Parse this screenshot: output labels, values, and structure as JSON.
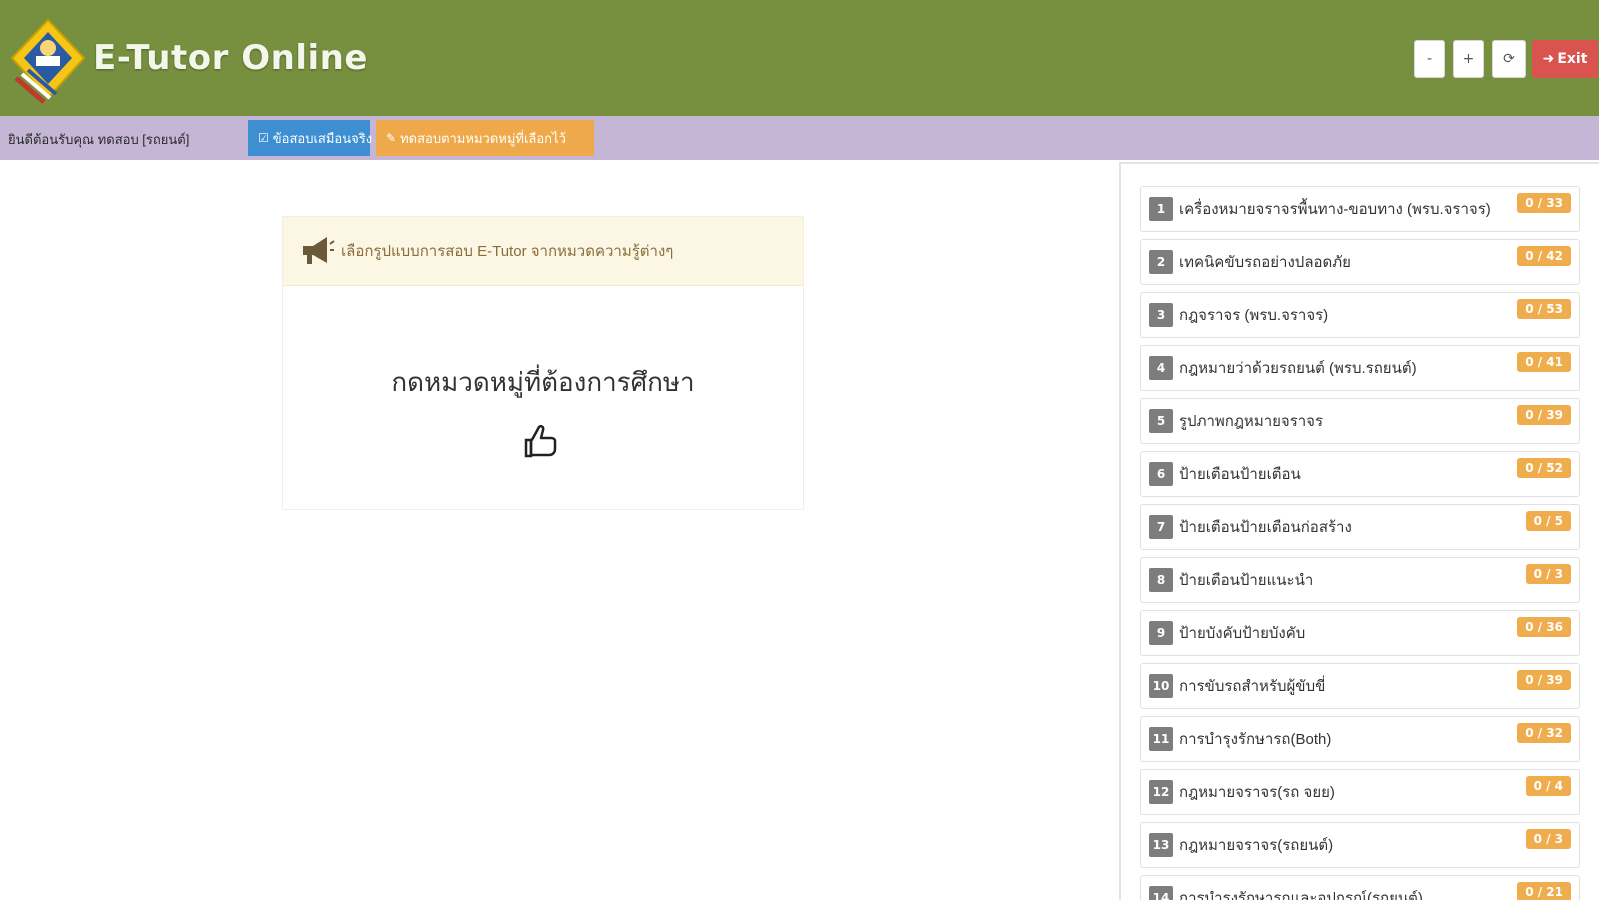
{
  "header": {
    "app_title": "E-Tutor Online",
    "buttons": [
      {
        "label": "-",
        "icon": "minus"
      },
      {
        "label": "+",
        "icon": "plus"
      },
      {
        "label": "⟳",
        "icon": "refresh-icon"
      }
    ],
    "exit_label": "Exit",
    "colors": {
      "header_bg": "#77903f",
      "exit_bg": "#d9534f"
    }
  },
  "subbar": {
    "welcome_text": "ยินดีต้อนรับคุณ ทดสอบ [รถยนต์]",
    "blue_button": "ข้อสอบเสมือนจริง",
    "orange_button": "ทดสอบตามหมวดหมู่ที่เลือกไว้",
    "colors": {
      "bar_bg": "#c5b6d6",
      "blue": "#3d8fd1",
      "orange": "#f0a94a"
    }
  },
  "info_panel": {
    "heading": "เลือกรูปแบบการสอบ E-Tutor จากหมวดความรู้ต่างๆ",
    "message": "กดหมวดหมู่ที่ต้องการศึกษา"
  },
  "categories": [
    {
      "num": "1",
      "name": "เครื่องหมายจราจรพื้นทาง-ขอบทาง (พรบ.จราจร)",
      "count": "0 / 33"
    },
    {
      "num": "2",
      "name": "เทคนิคขับรถอย่างปลอดภัย",
      "count": "0 / 42"
    },
    {
      "num": "3",
      "name": "กฎจราจร (พรบ.จราจร)",
      "count": "0 / 53"
    },
    {
      "num": "4",
      "name": "กฎหมายว่าด้วยรถยนต์ (พรบ.รถยนต์)",
      "count": "0 / 41"
    },
    {
      "num": "5",
      "name": "รูปภาพกฎหมายจราจร",
      "count": "0 / 39"
    },
    {
      "num": "6",
      "name": "ป้ายเตือนป้ายเตือน",
      "count": "0 / 52"
    },
    {
      "num": "7",
      "name": "ป้ายเตือนป้ายเตือนก่อสร้าง",
      "count": "0 / 5"
    },
    {
      "num": "8",
      "name": "ป้ายเตือนป้ายแนะนำ",
      "count": "0 / 3"
    },
    {
      "num": "9",
      "name": "ป้ายบังคับป้ายบังคับ",
      "count": "0 / 36"
    },
    {
      "num": "10",
      "name": "การขับรถสำหรับผู้ขับขี่",
      "count": "0 / 39"
    },
    {
      "num": "11",
      "name": "การบำรุงรักษารถ(Both)",
      "count": "0 / 32"
    },
    {
      "num": "12",
      "name": "กฎหมายจราจร(รถ จยย)",
      "count": "0 / 4"
    },
    {
      "num": "13",
      "name": "กฎหมายจราจร(รถยนต์)",
      "count": "0 / 3"
    },
    {
      "num": "14",
      "name": "การบำรุงรักษารถและอุปกรณ์(รถยนต์)",
      "count": "0 / 21"
    }
  ]
}
